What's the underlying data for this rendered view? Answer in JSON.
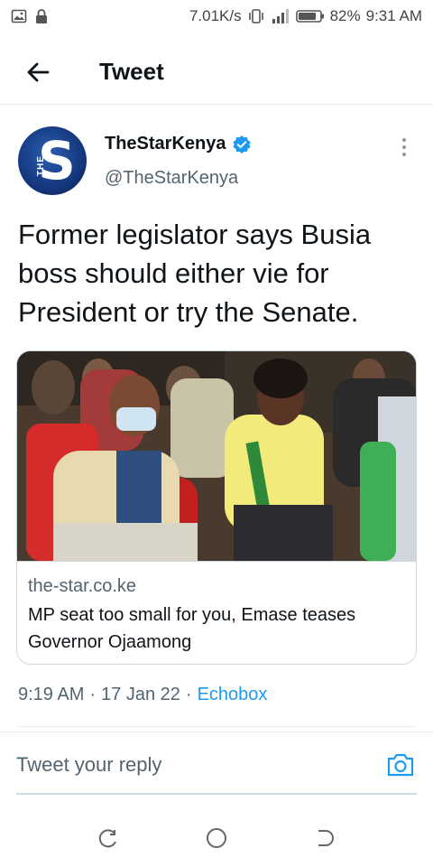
{
  "status_bar": {
    "speed": "7.01K/s",
    "battery_percent": "82%",
    "time": "9:31 AM",
    "battery_level": 0.82,
    "icons": [
      "image-icon",
      "lock-icon",
      "vibrate-icon",
      "signal-icon",
      "battery-icon"
    ]
  },
  "header": {
    "title": "Tweet",
    "back_icon": "arrow-left-icon"
  },
  "tweet": {
    "author_name": "TheStarKenya",
    "author_handle": "@TheStarKenya",
    "verified": true,
    "avatar_letter": "S",
    "avatar_small_text": "THE",
    "text": "Former legislator says Busia boss should either vie for President or try the Senate.",
    "card": {
      "domain": "the-star.co.ke",
      "title": "MP seat too small for you, Emase teases Governor Ojaamong"
    },
    "time": "9:19 AM",
    "date": "17 Jan 22",
    "source": "Echobox",
    "separator": "·"
  },
  "reply": {
    "placeholder": "Tweet your reply",
    "camera_icon": "camera-icon"
  },
  "colors": {
    "accent": "#1d9bf0",
    "text_primary": "#0f1419",
    "text_secondary": "#536471",
    "border": "#cfd9de"
  },
  "nav_bar": {
    "icons": [
      "recent-apps-icon",
      "home-icon",
      "back-nav-icon"
    ]
  }
}
